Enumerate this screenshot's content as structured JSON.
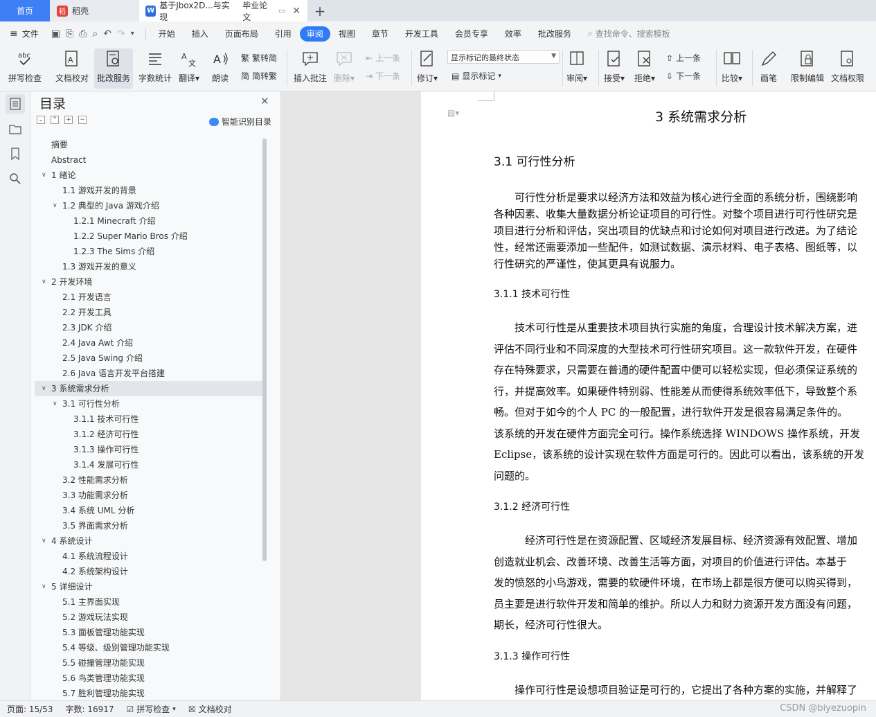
{
  "tabs": {
    "home": "首页",
    "daoke": "稻壳",
    "doc_title": "基于Jbox2D...与实现",
    "doc_subtitle": "毕业论文",
    "add": "+"
  },
  "menu": {
    "file": "文件",
    "items": [
      "开始",
      "插入",
      "页面布局",
      "引用",
      "审阅",
      "视图",
      "章节",
      "开发工具",
      "会员专享",
      "效率",
      "批改服务"
    ],
    "active": "审阅",
    "search": "查找命令、搜索模板"
  },
  "ribbon": {
    "spell": "拼写检查",
    "doccheck": "文档校对",
    "review_service": "批改服务",
    "wordcount": "字数统计",
    "translate": "翻译",
    "read": "朗读",
    "to_trad": "繁转简",
    "to_simp": "简转繁",
    "insert_comment": "插入批注",
    "delete": "删除",
    "prev1": "上一条",
    "next1": "下一条",
    "revise": "修订",
    "markup_mode": "显示标记的最终状态",
    "show_markup": "显示标记",
    "review": "审阅",
    "accept": "接受",
    "reject": "拒绝",
    "prev2": "上一条",
    "next2": "下一条",
    "compare": "比较",
    "pen": "画笔",
    "restrict": "限制编辑",
    "permission": "文档权限"
  },
  "toc": {
    "title": "目录",
    "smart": "智能识别目录",
    "items": [
      {
        "text": "摘要",
        "level": 0,
        "chevron": false
      },
      {
        "text": "Abstract",
        "level": 0,
        "chevron": false
      },
      {
        "text": "1  绪论",
        "level": 0,
        "chevron": true
      },
      {
        "text": "1.1  游戏开发的背景",
        "level": 1,
        "chevron": false
      },
      {
        "text": "1.2  典型的 Java 游戏介绍",
        "level": 1,
        "chevron": true
      },
      {
        "text": "1.2.1 Minecraft 介绍",
        "level": 2,
        "chevron": false
      },
      {
        "text": "1.2.2 Super Mario Bros 介绍",
        "level": 2,
        "chevron": false
      },
      {
        "text": "1.2.3 The Sims 介绍",
        "level": 2,
        "chevron": false
      },
      {
        "text": "1.3  游戏开发的意义",
        "level": 1,
        "chevron": false
      },
      {
        "text": "2  开发环境",
        "level": 0,
        "chevron": true
      },
      {
        "text": "2.1  开发语言",
        "level": 1,
        "chevron": false
      },
      {
        "text": "2.2  开发工具",
        "level": 1,
        "chevron": false
      },
      {
        "text": "2.3 JDK 介绍",
        "level": 1,
        "chevron": false
      },
      {
        "text": "2.4 Java Awt 介绍",
        "level": 1,
        "chevron": false
      },
      {
        "text": "2.5 Java Swing  介绍",
        "level": 1,
        "chevron": false
      },
      {
        "text": "2.6 Java 语言开发平台搭建",
        "level": 1,
        "chevron": false
      },
      {
        "text": "3 系统需求分析",
        "level": 0,
        "chevron": true,
        "selected": true
      },
      {
        "text": "3.1  可行性分析",
        "level": 1,
        "chevron": true
      },
      {
        "text": "3.1.1  技术可行性",
        "level": 2,
        "chevron": false
      },
      {
        "text": "3.1.2  经济可行性",
        "level": 2,
        "chevron": false
      },
      {
        "text": "3.1.3  操作可行性",
        "level": 2,
        "chevron": false
      },
      {
        "text": "3.1.4  发展可行性",
        "level": 2,
        "chevron": false
      },
      {
        "text": "3.2  性能需求分析",
        "level": 1,
        "chevron": false
      },
      {
        "text": "3.3  功能需求分析",
        "level": 1,
        "chevron": false
      },
      {
        "text": "3.4  系统 UML 分析",
        "level": 1,
        "chevron": false
      },
      {
        "text": "3.5 界面需求分析",
        "level": 1,
        "chevron": false
      },
      {
        "text": "4  系统设计",
        "level": 0,
        "chevron": true
      },
      {
        "text": "4.1 系统流程设计",
        "level": 1,
        "chevron": false
      },
      {
        "text": "4.2  系统架构设计",
        "level": 1,
        "chevron": false
      },
      {
        "text": "5  详细设计",
        "level": 0,
        "chevron": true
      },
      {
        "text": "5.1  主界面实现",
        "level": 1,
        "chevron": false
      },
      {
        "text": "5.2  游戏玩法实现",
        "level": 1,
        "chevron": false
      },
      {
        "text": "5.3  面板管理功能实现",
        "level": 1,
        "chevron": false
      },
      {
        "text": "5.4  等级、级别管理功能实现",
        "level": 1,
        "chevron": false
      },
      {
        "text": "5.5  碰撞管理功能实现",
        "level": 1,
        "chevron": false
      },
      {
        "text": "5.6  鸟类管理功能实现",
        "level": 1,
        "chevron": false
      },
      {
        "text": "5.7  胜利管理功能实现",
        "level": 1,
        "chevron": false
      }
    ]
  },
  "document": {
    "chapter_title": "3 系统需求分析",
    "s31": "3.1  可行性分析",
    "p1": [
      "　　可行性分析是要求以经济方法和效益为核心进行全面的系统分析，围绕影响",
      "各种因素、收集大量数据分析论证项目的可行性。对整个项目进行可行性研究是",
      "项目进行分析和评估，突出项目的优缺点和讨论如何对项目进行改进。为了结论",
      "性，经常还需要添加一些配件，如测试数据、演示材料、电子表格、图纸等，以",
      "行性研究的严谨性，使其更具有说服力。"
    ],
    "s311": "3.1.1  技术可行性",
    "p2": [
      "　　技术可行性是从重要技术项目执行实施的角度，合理设计技术解决方案，进",
      "评估不同行业和不同深度的大型技术可行性研究项目。这一款软件开发，在硬件",
      "存在特殊要求，只需要在普通的硬件配置中便可以轻松实现，但必须保证系统的",
      "行，并提高效率。如果硬件特别弱、性能差从而使得系统效率低下，导致整个系",
      "畅。但对于如今的个人 PC 的一般配置，进行软件开发是很容易满足条件的。",
      "该系统的开发在硬件方面完全可行。操作系统选择 WINDOWS 操作系统，开发",
      "Eclipse，该系统的设计实现在软件方面是可行的。因此可以看出，该系统的开发",
      "问题的。"
    ],
    "s312": "3.1.2  经济可行性",
    "p3": [
      "　　　经济可行性是在资源配置、区域经济发展目标、经济资源有效配置、增加",
      "创造就业机会、改善环境、改善生活等方面，对项目的价值进行评估。本基于",
      "发的愤怒的小鸟游戏，需要的软硬件环境，在市场上都是很方便可以购买得到，",
      "员主要是进行软件开发和简单的维护。所以人力和财力资源开发方面没有问题，",
      "期长，经济可行性很大。"
    ],
    "s313": "3.1.3  操作可行性",
    "p4": [
      "　　操作可行性是设想项目验证是可行的，它提出了各种方案的实施，并解释了"
    ]
  },
  "status": {
    "page": "页面: 15/53",
    "words": "字数: 16917",
    "spell": "拼写检查",
    "doccheck": "文档校对",
    "watermark": "CSDN @biyezuopin"
  }
}
